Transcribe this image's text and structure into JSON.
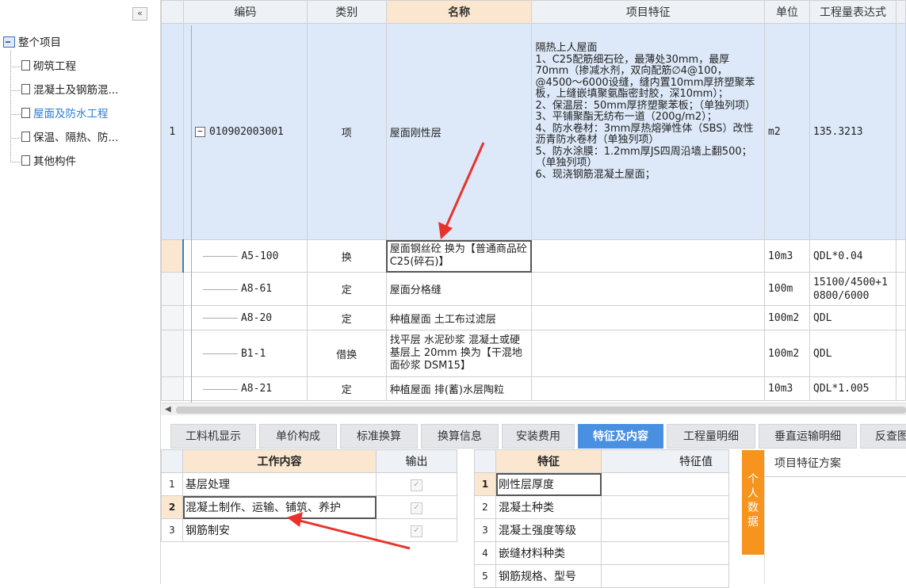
{
  "tree": {
    "collapse_label": "«",
    "root": "整个项目",
    "items": [
      {
        "label": "砌筑工程"
      },
      {
        "label": "混凝土及钢筋混..."
      },
      {
        "label": "屋面及防水工程"
      },
      {
        "label": "保温、隔热、防..."
      },
      {
        "label": "其他构件"
      }
    ]
  },
  "grid": {
    "headers": {
      "code": "编码",
      "type": "类别",
      "name": "名称",
      "feature": "项目特征",
      "unit": "单位",
      "expr": "工程量表达式"
    },
    "main_row": {
      "num": "1",
      "toggle": "−",
      "code": "010902003001",
      "type": "项",
      "name": "屋面刚性层",
      "feature": "隔热上人屋面\n1、C25配筋细石砼，最薄处30mm，最厚70mm（掺减水剂，双向配筋∅4@100，@4500～6000设缝，缝内置10mm厚挤塑聚苯板，上缝嵌填聚氨酯密封胶，深10mm）；\n2、保温层：50mm厚挤塑聚苯板；（单独列项）\n3、平铺聚酯无纺布一道（200g/m2）；\n4、防水卷材：3mm厚热熔弹性体（SBS）改性沥青防水卷材（单独列项）\n5、防水涂膜：1.2mm厚JS四周沿墙上翻500；（单独列项）\n6、现浇钢筋混凝土屋面；",
      "unit": "m2",
      "expr": "135.3213"
    },
    "sub_rows": [
      {
        "code": "A5-100",
        "type": "换",
        "name": "屋面钢丝砼   换为【普通商品砼 C25(碎石)】",
        "unit": "10m3",
        "expr": "QDL*0.04"
      },
      {
        "code": "A8-61",
        "type": "定",
        "name": "屋面分格缝",
        "unit": "100m",
        "expr": "15100/4500+10800/6000"
      },
      {
        "code": "A8-20",
        "type": "定",
        "name": "种植屋面 土工布过滤层",
        "unit": "100m2",
        "expr": "QDL"
      },
      {
        "code": "B1-1",
        "type": "借换",
        "name": "找平层 水泥砂浆 混凝土或硬基层上 20mm   换为【干混地面砂浆 DSM15】",
        "unit": "100m2",
        "expr": "QDL"
      },
      {
        "code": "A8-21",
        "type": "定",
        "name": "种植屋面 排(蓄)水层陶粒",
        "unit": "10m3",
        "expr": "QDL*1.005"
      }
    ]
  },
  "scroll_arrow": "◀",
  "tabs": [
    "工料机显示",
    "单价构成",
    "标准换算",
    "换算信息",
    "安装费用",
    "特征及内容",
    "工程量明细",
    "垂直运输明细",
    "反查图"
  ],
  "active_tab": "特征及内容",
  "work": {
    "headers": {
      "content": "工作内容",
      "output": "输出"
    },
    "rows": [
      {
        "num": "1",
        "content": "基层处理",
        "checked": "✓"
      },
      {
        "num": "2",
        "content": "混凝土制作、运输、铺筑、养护",
        "checked": "✓"
      },
      {
        "num": "3",
        "content": "钢筋制安",
        "checked": "✓"
      }
    ]
  },
  "features": {
    "headers": {
      "feature": "特征",
      "value": "特征值"
    },
    "rows": [
      {
        "num": "1",
        "feature": "刚性层厚度"
      },
      {
        "num": "2",
        "feature": "混凝土种类"
      },
      {
        "num": "3",
        "feature": "混凝土强度等级"
      },
      {
        "num": "4",
        "feature": "嵌缝材料种类"
      },
      {
        "num": "5",
        "feature": "钢筋规格、型号"
      }
    ]
  },
  "personal_data": "个人数据",
  "scheme_title": "项目特征方案",
  "colors": {
    "accent": "#4a90e2",
    "orange": "#f7941d",
    "selected_header": "#fbe7cf",
    "selected_row": "#dde9f9",
    "arrow": "#e8322b"
  }
}
